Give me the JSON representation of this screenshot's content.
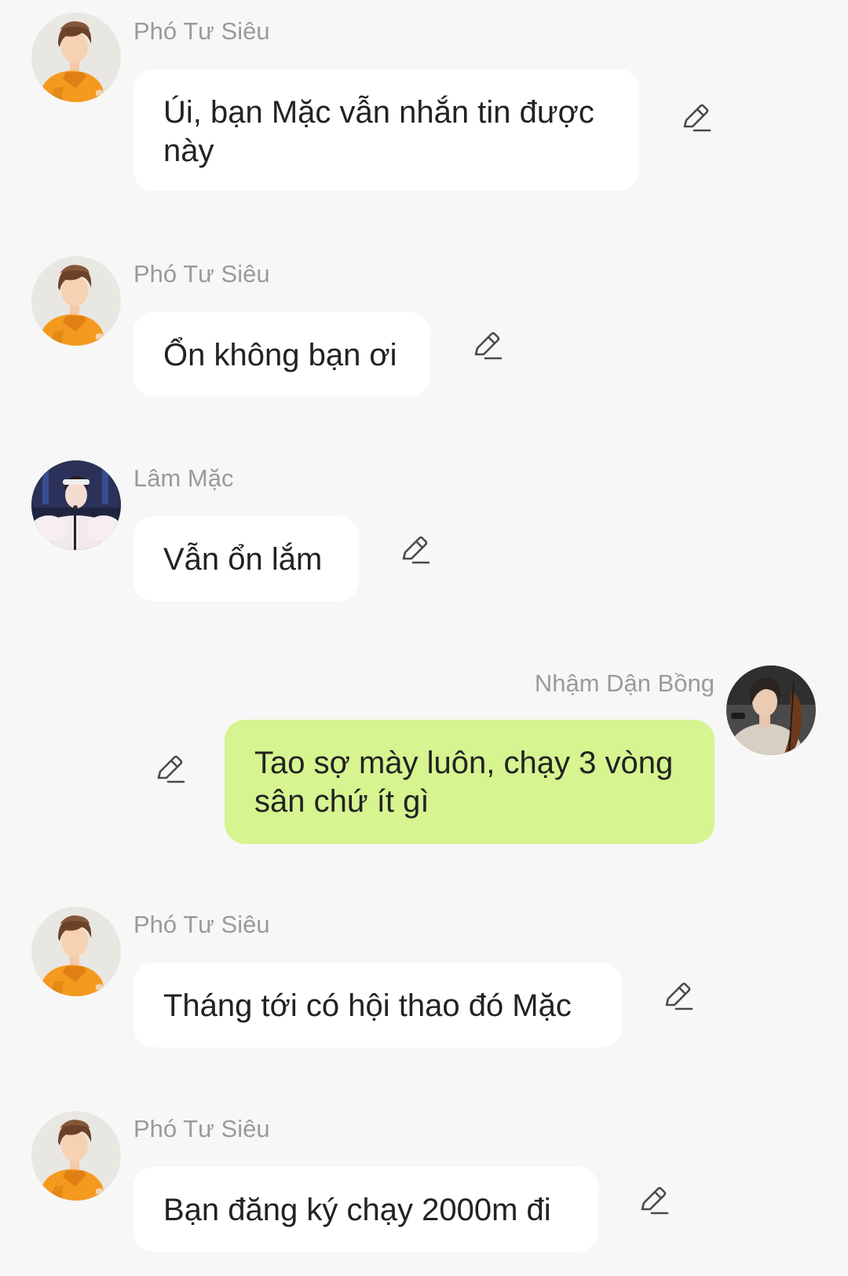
{
  "messages": [
    {
      "sender": "Phó Tư Siêu",
      "text": "Úi, bạn Mặc vẫn nhắn tin được này",
      "direction": "incoming",
      "avatar": "orange-outfit-avatar"
    },
    {
      "sender": "Phó Tư Siêu",
      "text": "Ổn không bạn ơi",
      "direction": "incoming",
      "avatar": "orange-outfit-avatar"
    },
    {
      "sender": "Lâm Mặc",
      "text": "Vẫn ổn lắm",
      "direction": "incoming",
      "avatar": "stage-singer-avatar"
    },
    {
      "sender": "Nhậm Dận Bồng",
      "text": "Tao sợ mày luôn, chạy 3 vòng sân chứ ít gì",
      "direction": "outgoing",
      "avatar": "cellist-avatar"
    },
    {
      "sender": "Phó Tư Siêu",
      "text": "Tháng tới có hội thao đó Mặc",
      "direction": "incoming",
      "avatar": "orange-outfit-avatar"
    },
    {
      "sender": "Phó Tư Siêu",
      "text": "Bạn đăng ký chạy 2000m đi",
      "direction": "incoming",
      "avatar": "orange-outfit-avatar"
    }
  ],
  "icons": {
    "edit": "pencil-edit-icon"
  },
  "colors": {
    "background": "#f7f7f7",
    "incoming_bubble": "#ffffff",
    "outgoing_bubble": "#d6f490",
    "sender_name": "#9a9a9a",
    "message_text": "#222222"
  }
}
